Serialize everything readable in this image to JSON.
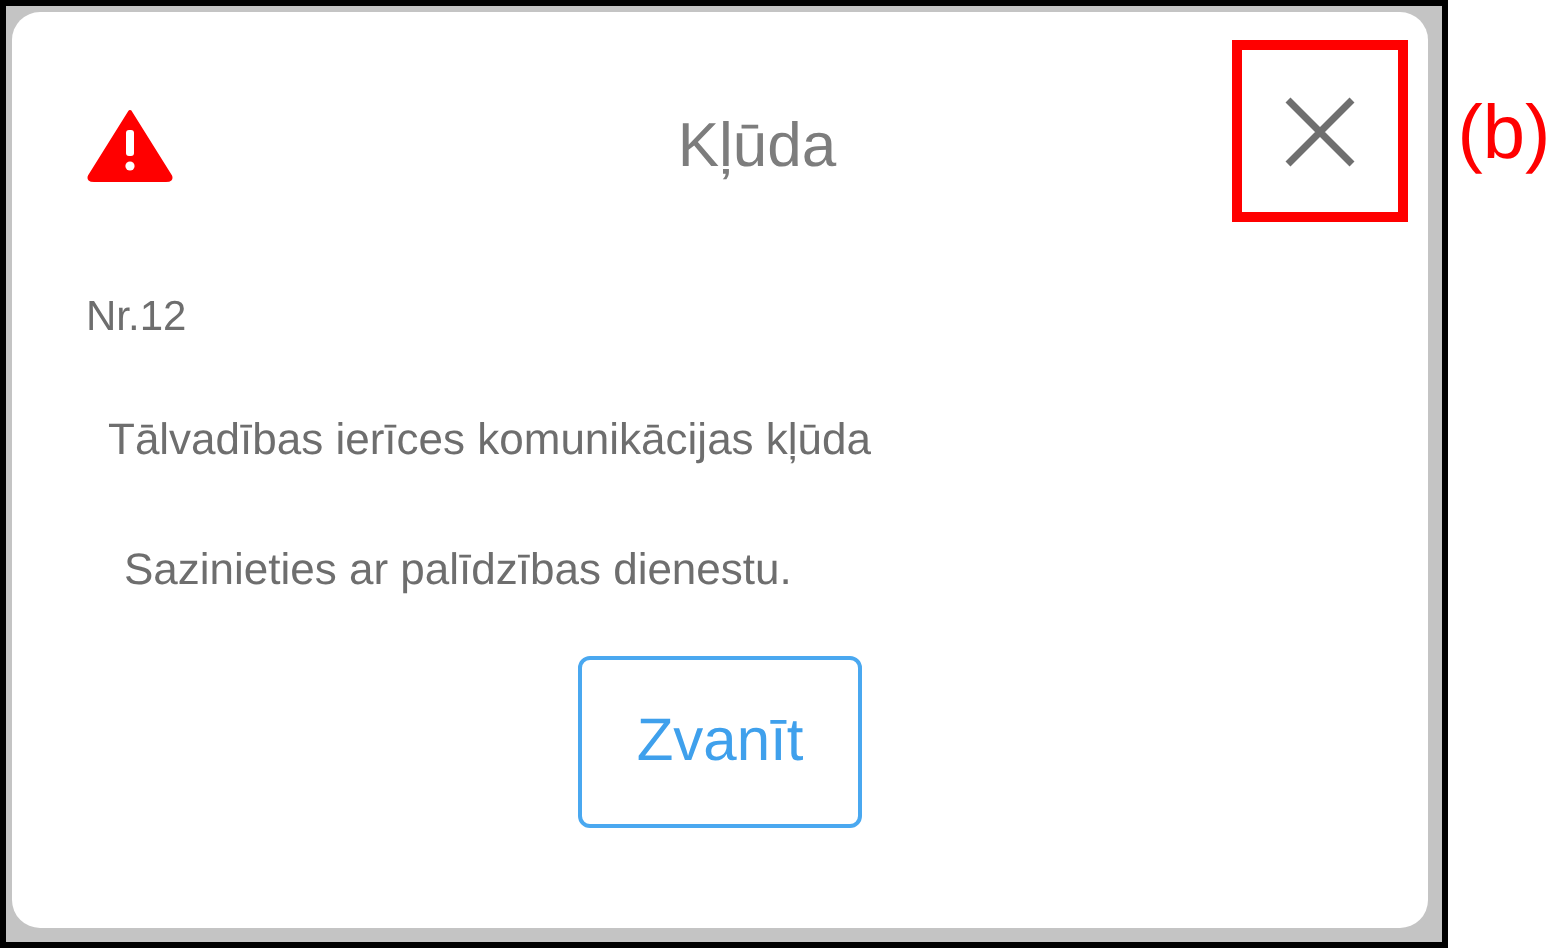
{
  "dialog": {
    "title": "Kļūda",
    "close_button": {
      "highlighted": true
    },
    "code": "Nr.12",
    "message": "Tālvadības ierīces komunikācijas kļūda",
    "hint": "Sazinieties ar palīdzības dienestu.",
    "action": "Zvanīt"
  },
  "annotation": {
    "label": "(b)"
  }
}
